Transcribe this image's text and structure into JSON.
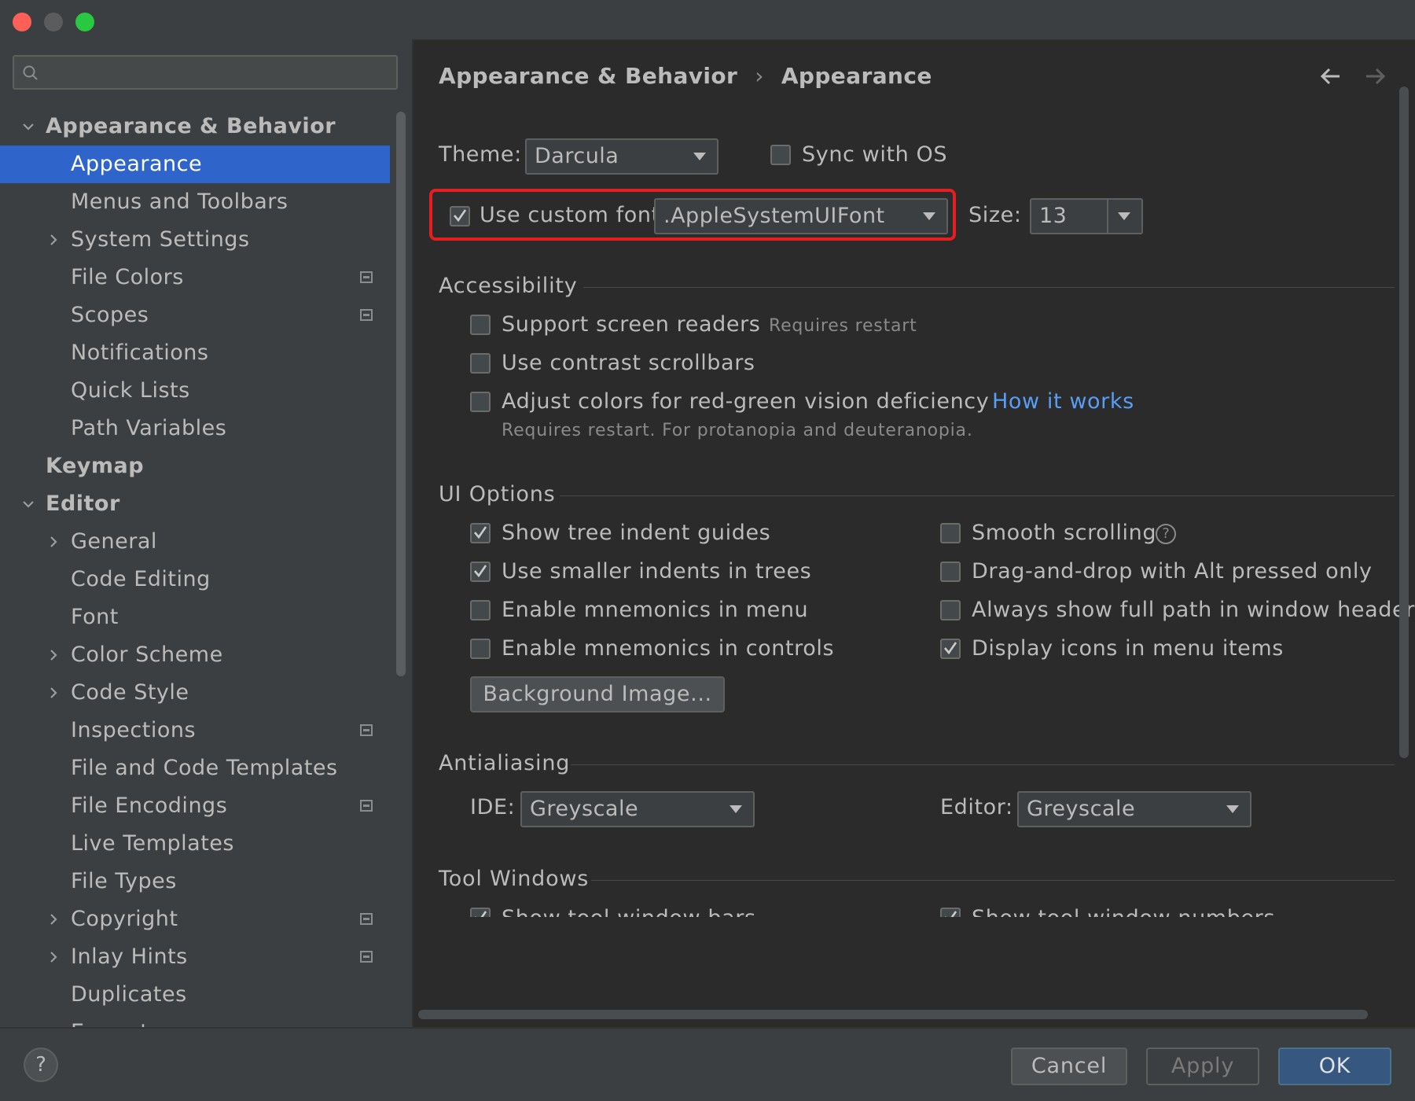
{
  "search": {
    "placeholder": ""
  },
  "sidebar": {
    "items": [
      {
        "label": "Appearance & Behavior",
        "level": 0,
        "chevron": "down",
        "bold": true
      },
      {
        "label": "Appearance",
        "level": 1,
        "selected": true
      },
      {
        "label": "Menus and Toolbars",
        "level": 1
      },
      {
        "label": "System Settings",
        "level": 1,
        "chevron": "right"
      },
      {
        "label": "File Colors",
        "level": 1,
        "project_icon": true
      },
      {
        "label": "Scopes",
        "level": 1,
        "project_icon": true
      },
      {
        "label": "Notifications",
        "level": 1
      },
      {
        "label": "Quick Lists",
        "level": 1
      },
      {
        "label": "Path Variables",
        "level": 1
      },
      {
        "label": "Keymap",
        "level": 0,
        "bold": true
      },
      {
        "label": "Editor",
        "level": 0,
        "chevron": "down",
        "bold": true
      },
      {
        "label": "General",
        "level": 1,
        "chevron": "right"
      },
      {
        "label": "Code Editing",
        "level": 1
      },
      {
        "label": "Font",
        "level": 1
      },
      {
        "label": "Color Scheme",
        "level": 1,
        "chevron": "right"
      },
      {
        "label": "Code Style",
        "level": 1,
        "chevron": "right"
      },
      {
        "label": "Inspections",
        "level": 1,
        "project_icon": true
      },
      {
        "label": "File and Code Templates",
        "level": 1
      },
      {
        "label": "File Encodings",
        "level": 1,
        "project_icon": true
      },
      {
        "label": "Live Templates",
        "level": 1
      },
      {
        "label": "File Types",
        "level": 1
      },
      {
        "label": "Copyright",
        "level": 1,
        "chevron": "right",
        "project_icon": true
      },
      {
        "label": "Inlay Hints",
        "level": 1,
        "chevron": "right",
        "project_icon": true
      },
      {
        "label": "Duplicates",
        "level": 1
      },
      {
        "label": "Emmet",
        "level": 1,
        "chevron": "right"
      }
    ]
  },
  "breadcrumb": {
    "parent": "Appearance & Behavior",
    "separator": "›",
    "current": "Appearance"
  },
  "theme": {
    "label": "Theme:",
    "value": "Darcula",
    "sync_label": "Sync with OS",
    "sync_checked": false
  },
  "custom_font": {
    "label": "Use custom font:",
    "checked": true,
    "value": ".AppleSystemUIFont",
    "size_label": "Size:",
    "size_value": "13"
  },
  "accessibility": {
    "title": "Accessibility",
    "screen_readers": "Support screen readers",
    "requires_restart": "Requires restart",
    "contrast_scrollbars": "Use contrast scrollbars",
    "adjust_colors": "Adjust colors for red-green vision deficiency",
    "how_it_works": "How it works",
    "adjust_hint": "Requires restart. For protanopia and deuteranopia."
  },
  "ui_options": {
    "title": "UI Options",
    "left": [
      {
        "label": "Show tree indent guides",
        "checked": true
      },
      {
        "label": "Use smaller indents in trees",
        "checked": true
      },
      {
        "label": "Enable mnemonics in menu",
        "checked": false
      },
      {
        "label": "Enable mnemonics in controls",
        "checked": false
      }
    ],
    "right": [
      {
        "label": "Smooth scrolling",
        "checked": false,
        "help": "?"
      },
      {
        "label": "Drag-and-drop with Alt pressed only",
        "checked": false
      },
      {
        "label": "Always show full path in window header",
        "checked": false
      },
      {
        "label": "Display icons in menu items",
        "checked": true
      }
    ],
    "background_button": "Background Image..."
  },
  "antialiasing": {
    "title": "Antialiasing",
    "ide_label": "IDE:",
    "ide_value": "Greyscale",
    "editor_label": "Editor:",
    "editor_value": "Greyscale"
  },
  "tool_windows": {
    "title": "Tool Windows",
    "show_bars": "Show tool window bars",
    "show_numbers": "Show tool window numbers"
  },
  "footer": {
    "help": "?",
    "cancel": "Cancel",
    "apply": "Apply",
    "ok": "OK"
  },
  "colors": {
    "accent": "#2f65ca",
    "link": "#589df6",
    "highlight": "#e51e21",
    "ok_button": "#365880"
  }
}
